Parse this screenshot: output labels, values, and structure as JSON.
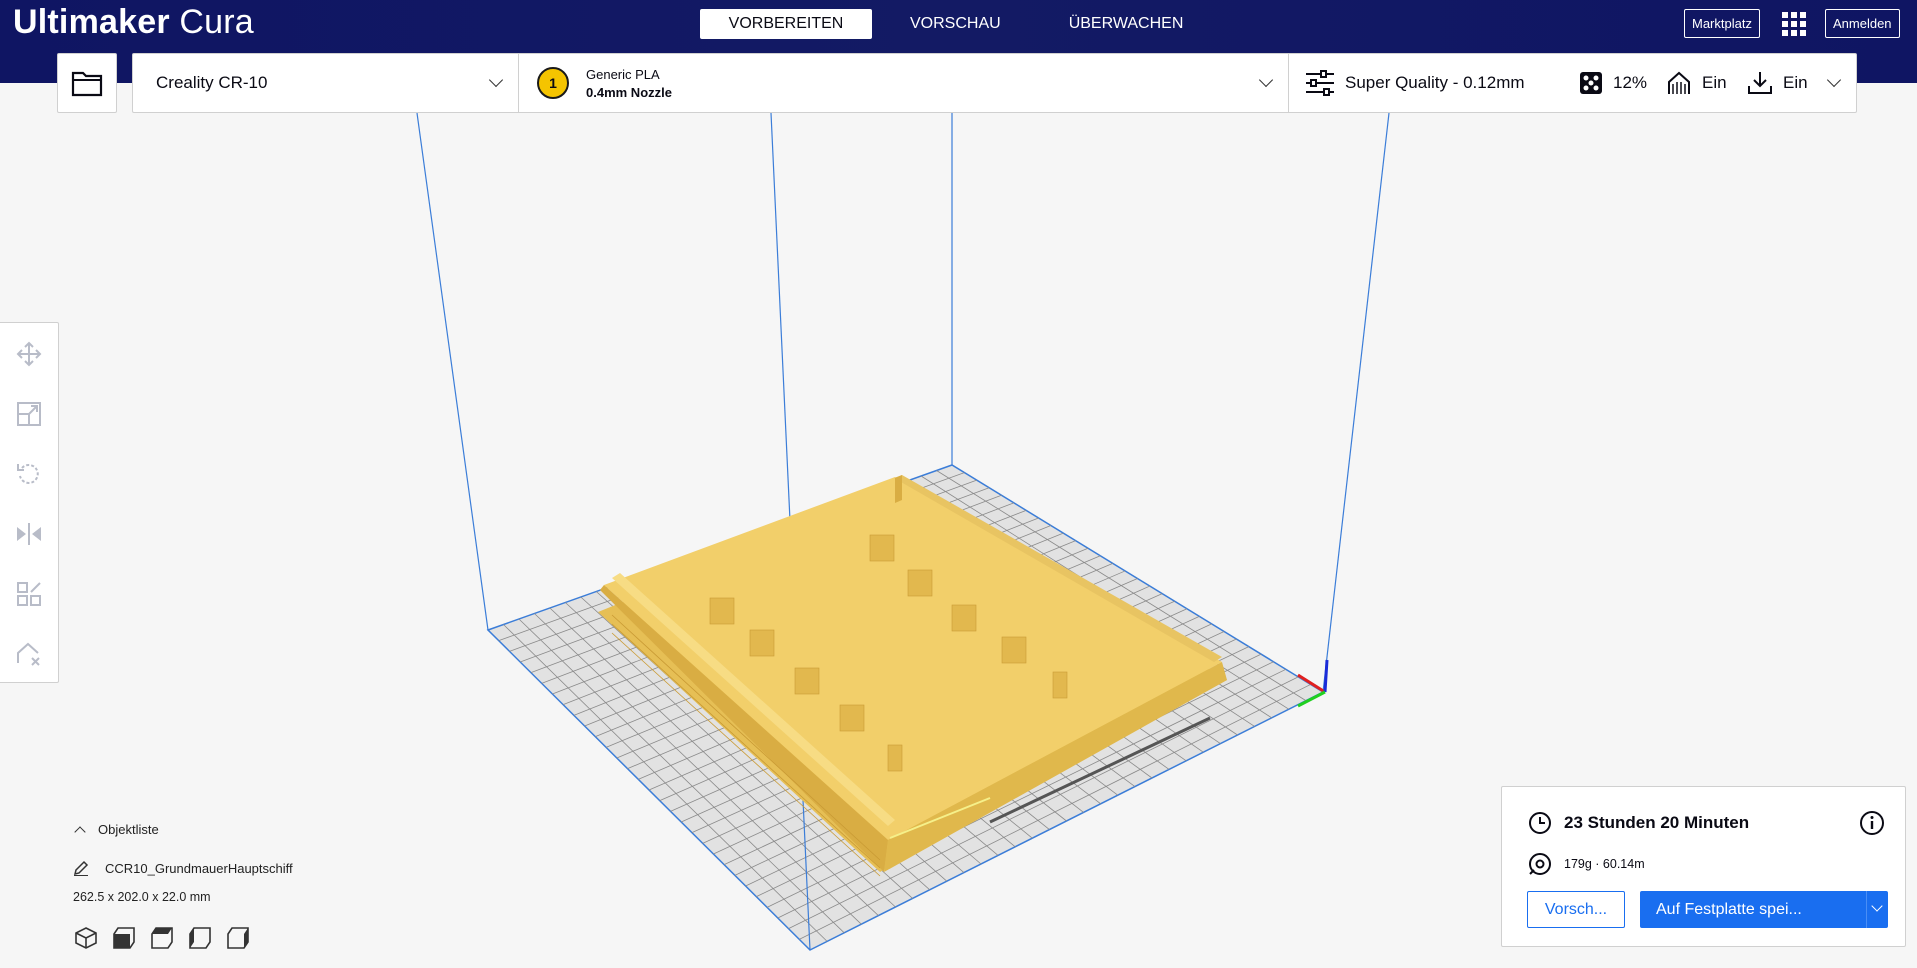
{
  "header": {
    "brand": "Ultimaker",
    "product": "Cura",
    "stages": [
      "VORBEREITEN",
      "VORSCHAU",
      "ÜBERWACHEN"
    ],
    "active_stage": "VORBEREITEN",
    "marketplace_label": "Marktplatz",
    "signin_label": "Anmelden"
  },
  "toolbar": {
    "printer": "Creality CR-10",
    "extruder_number": "1",
    "material": "Generic PLA",
    "nozzle": "0.4mm Nozzle",
    "profile": "Super Quality - 0.12mm",
    "infill": "12%",
    "support": "Ein",
    "adhesion": "Ein"
  },
  "object_list": {
    "title": "Objektliste",
    "item_name": "CCR10_GrundmauerHauptschiff",
    "dimensions": "262.5 x 202.0 x 22.0 mm"
  },
  "print_panel": {
    "time": "23 Stunden 20 Minuten",
    "material_usage": "179g · 60.14m",
    "preview_label": "Vorsch...",
    "save_label": "Auf Festplatte spei..."
  },
  "colors": {
    "header_bg": "#131a64",
    "accent_blue": "#196ef0",
    "model_yellow": "#f2cf6a",
    "build_volume_line": "#3b7dd8"
  }
}
